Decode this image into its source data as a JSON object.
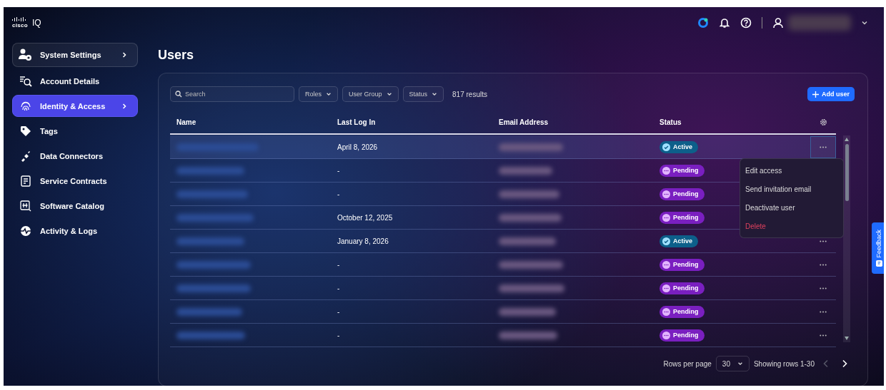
{
  "brand": {
    "logo_text": "cisco",
    "product": "IQ"
  },
  "sidebar": {
    "items": [
      {
        "label": "System Settings",
        "kind": "section",
        "selected": false,
        "chevron": true
      },
      {
        "label": "Account Details",
        "kind": "item",
        "selected": false,
        "chevron": false
      },
      {
        "label": "Identity & Access",
        "kind": "item",
        "selected": true,
        "chevron": true
      },
      {
        "label": "Tags",
        "kind": "item",
        "selected": false,
        "chevron": false
      },
      {
        "label": "Data Connectors",
        "kind": "item",
        "selected": false,
        "chevron": false
      },
      {
        "label": "Service Contracts",
        "kind": "item",
        "selected": false,
        "chevron": false
      },
      {
        "label": "Software Catalog",
        "kind": "item",
        "selected": false,
        "chevron": false
      },
      {
        "label": "Activity & Logs",
        "kind": "item",
        "selected": false,
        "chevron": false
      }
    ]
  },
  "page_title": "Users",
  "toolbar": {
    "search": {
      "placeholder": "Search"
    },
    "filters": [
      "Roles",
      "User Group",
      "Status"
    ],
    "results": "817 results",
    "add_button": "Add user"
  },
  "table": {
    "columns": [
      "Name",
      "Last Log In",
      "Email Address",
      "Status"
    ],
    "rows": [
      {
        "last_log_in": "April 8, 2026",
        "status": "Active",
        "kind": "active",
        "selected": true
      },
      {
        "last_log_in": "-",
        "status": "Pending",
        "kind": "pending",
        "selected": false
      },
      {
        "last_log_in": "-",
        "status": "Pending",
        "kind": "pending",
        "selected": false
      },
      {
        "last_log_in": "October 12, 2025",
        "status": "Pending",
        "kind": "pending",
        "selected": false
      },
      {
        "last_log_in": "January 8, 2026",
        "status": "Active",
        "kind": "active",
        "selected": false
      },
      {
        "last_log_in": "-",
        "status": "Pending",
        "kind": "pending",
        "selected": false
      },
      {
        "last_log_in": "-",
        "status": "Pending",
        "kind": "pending",
        "selected": false
      },
      {
        "last_log_in": "-",
        "status": "Pending",
        "kind": "pending",
        "selected": false
      },
      {
        "last_log_in": "-",
        "status": "Pending",
        "kind": "pending",
        "selected": false
      }
    ]
  },
  "row_menu": {
    "items": [
      {
        "label": "Edit access",
        "kind": "normal"
      },
      {
        "label": "Send invitation email",
        "kind": "normal"
      },
      {
        "label": "Deactivate user",
        "kind": "normal"
      },
      {
        "label": "Delete",
        "kind": "danger"
      }
    ]
  },
  "pagination": {
    "rows_per_page_label": "Rows per page",
    "rows_per_page": "30",
    "showing": "Showing rows 1-30",
    "prev_disabled": true,
    "next_disabled": false
  },
  "feedback_tab": "Feedback"
}
